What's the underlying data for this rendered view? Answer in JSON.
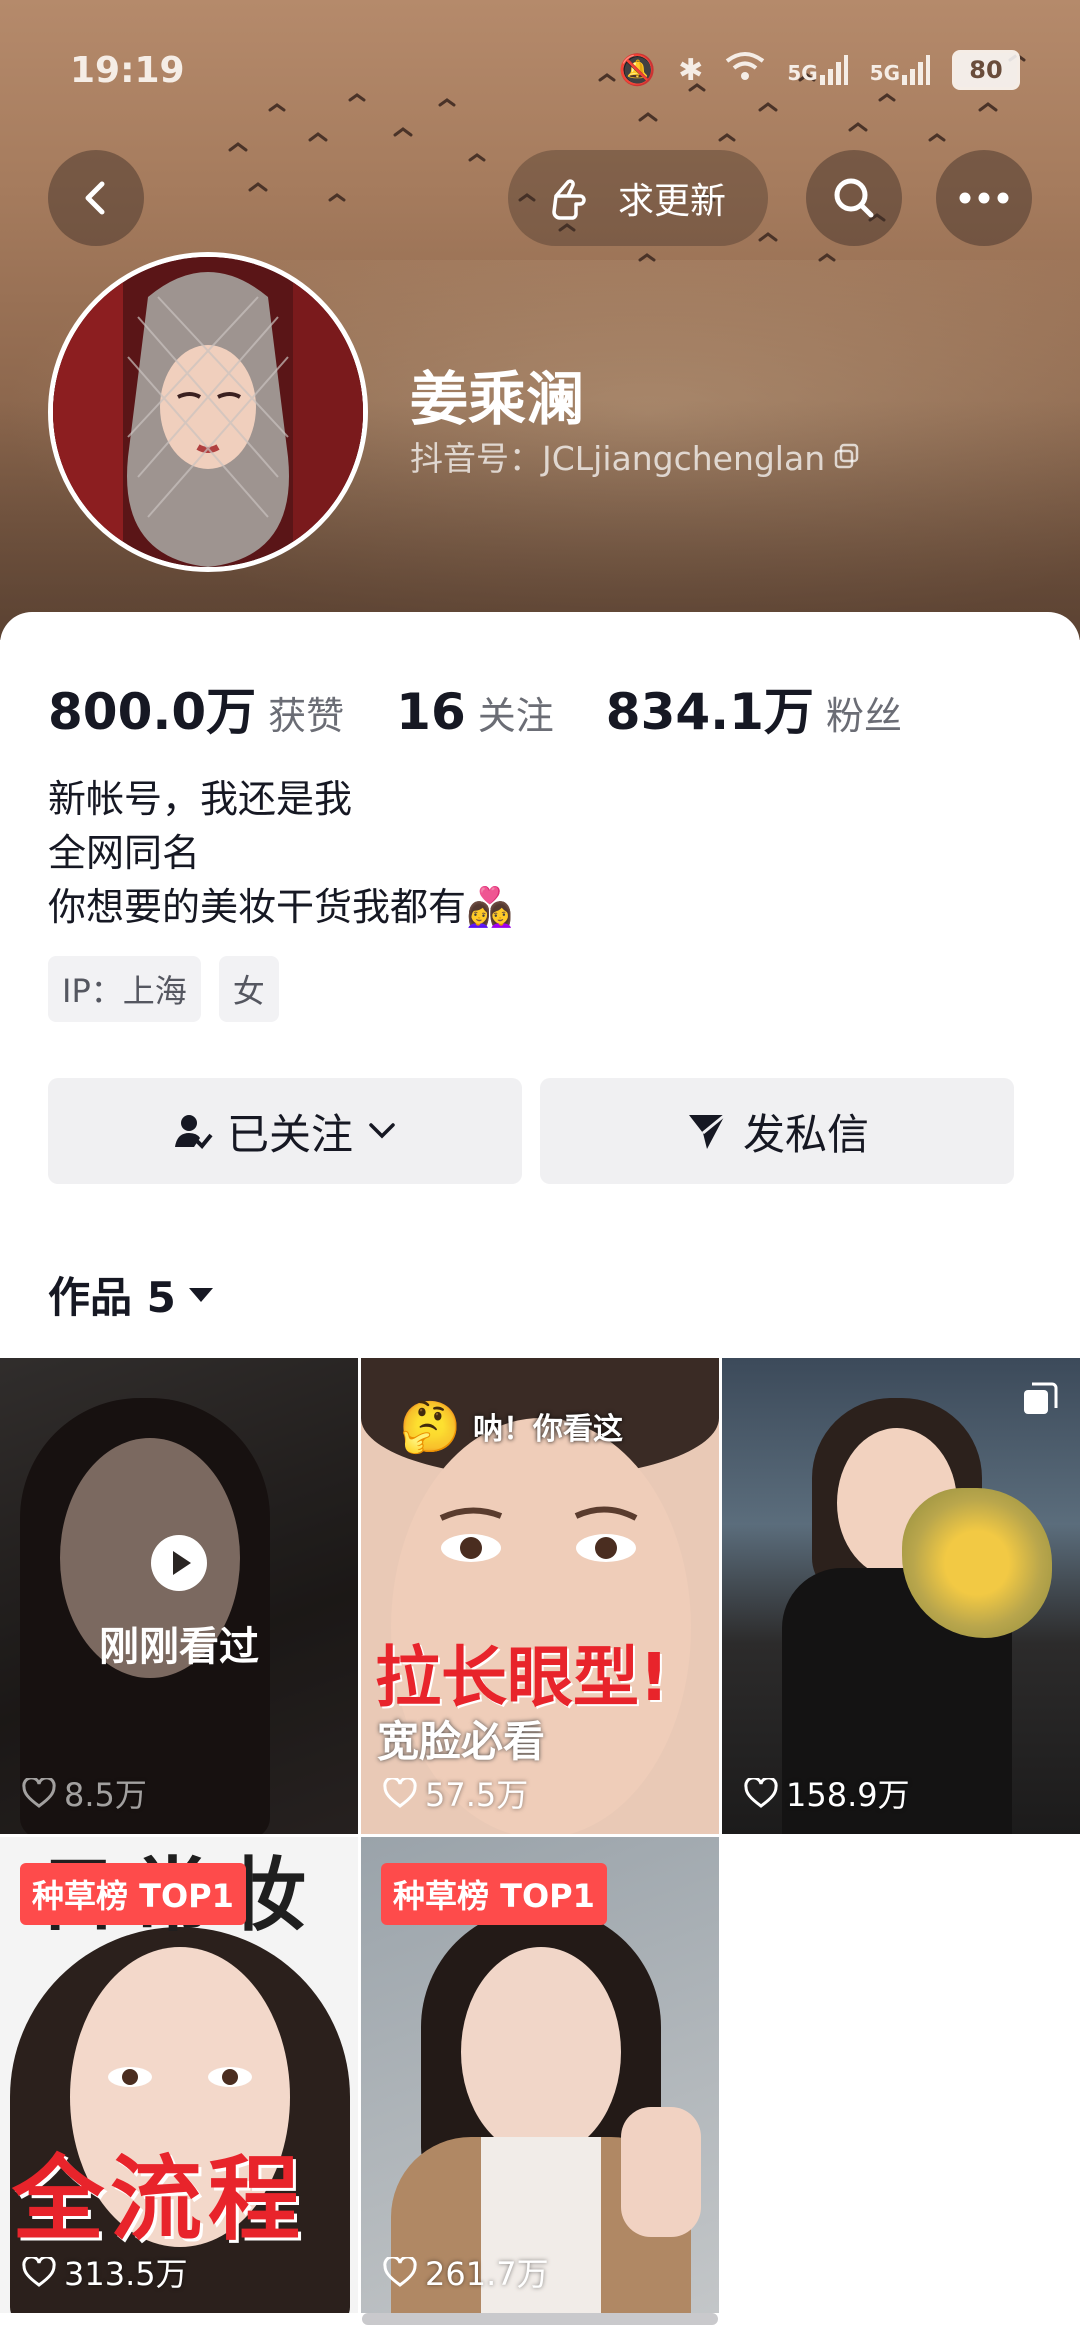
{
  "status_bar": {
    "time": "19:19",
    "network_1": "5G",
    "network_2": "5G",
    "battery": "80"
  },
  "header": {
    "request_update_label": "求更新"
  },
  "profile": {
    "name": "姜乘澜",
    "douyin_id": "抖音号：JCLjiangchenglan"
  },
  "stats": [
    {
      "value": "800.0万",
      "label": "获赞"
    },
    {
      "value": "16",
      "label": "关注"
    },
    {
      "value": "834.1万",
      "label": "粉丝"
    }
  ],
  "bio": [
    "新帐号，我还是我",
    "全网同名",
    "你想要的美妆干货我都有👩‍❤️‍👩"
  ],
  "tags": [
    "IP：上海",
    "女"
  ],
  "actions": {
    "followed_label": "已关注",
    "message_label": "发私信"
  },
  "works": {
    "tab_label": "作品 5",
    "items": [
      {
        "likes": "8.5万",
        "overlay": "刚刚看过"
      },
      {
        "likes": "57.5万",
        "caption_top": "呐！你看这",
        "caption_main": "拉长眼型!",
        "caption_sub": "宽脸必看"
      },
      {
        "likes": "158.9万"
      },
      {
        "likes": "313.5万",
        "badge": "种草榜 TOP1",
        "caption_top": "日常妆",
        "caption_main": "全流程"
      },
      {
        "likes": "261.7万",
        "badge": "种草榜 TOP1"
      }
    ]
  },
  "colors": {
    "accent_red": "#fe4b4b",
    "banner": "#a57b5d"
  }
}
